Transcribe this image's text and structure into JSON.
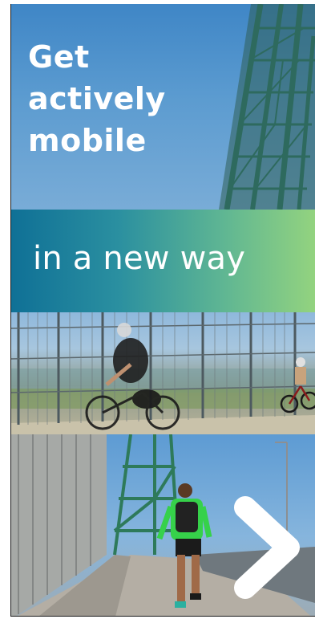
{
  "hero": {
    "title": "Get\nactively\nmobile"
  },
  "banner": {
    "text": "in a new way"
  },
  "navigation": {
    "next_icon": "chevron-right-icon",
    "next_icon_color": "#ffffff"
  },
  "colors": {
    "banner_gradient_start": "#0f7096",
    "banner_gradient_end": "#93d37f",
    "hero_sky": "#5b9bd0",
    "text": "#ffffff"
  }
}
